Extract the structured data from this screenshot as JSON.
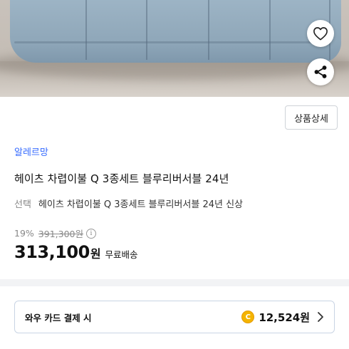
{
  "photo": {
    "alt_subject": "bedding-product-photo"
  },
  "actions": {
    "wishlist_icon": "heart-icon",
    "share_icon": "share-icon"
  },
  "product": {
    "detail_button": "상품상세",
    "brand": "알레르망",
    "title": "헤이츠 차렵이불 Q 3종세트 블루리버서블 24년",
    "option_label": "선택",
    "option_value": "헤이츠 차렵이불 Q 3종세트 블루리버서블 24년 신상",
    "discount_rate": "19%",
    "original_price": "391,300원",
    "price": "313,100",
    "price_unit": "원",
    "shipping": "무료배송"
  },
  "card_benefit": {
    "label": "와우 카드 결제 시",
    "coin_symbol": "C",
    "amount": "12,524원"
  },
  "colors": {
    "brand_blue": "#346aff",
    "coin_gold": "#f4b400",
    "quilt_blue": "#9fb6c7"
  }
}
